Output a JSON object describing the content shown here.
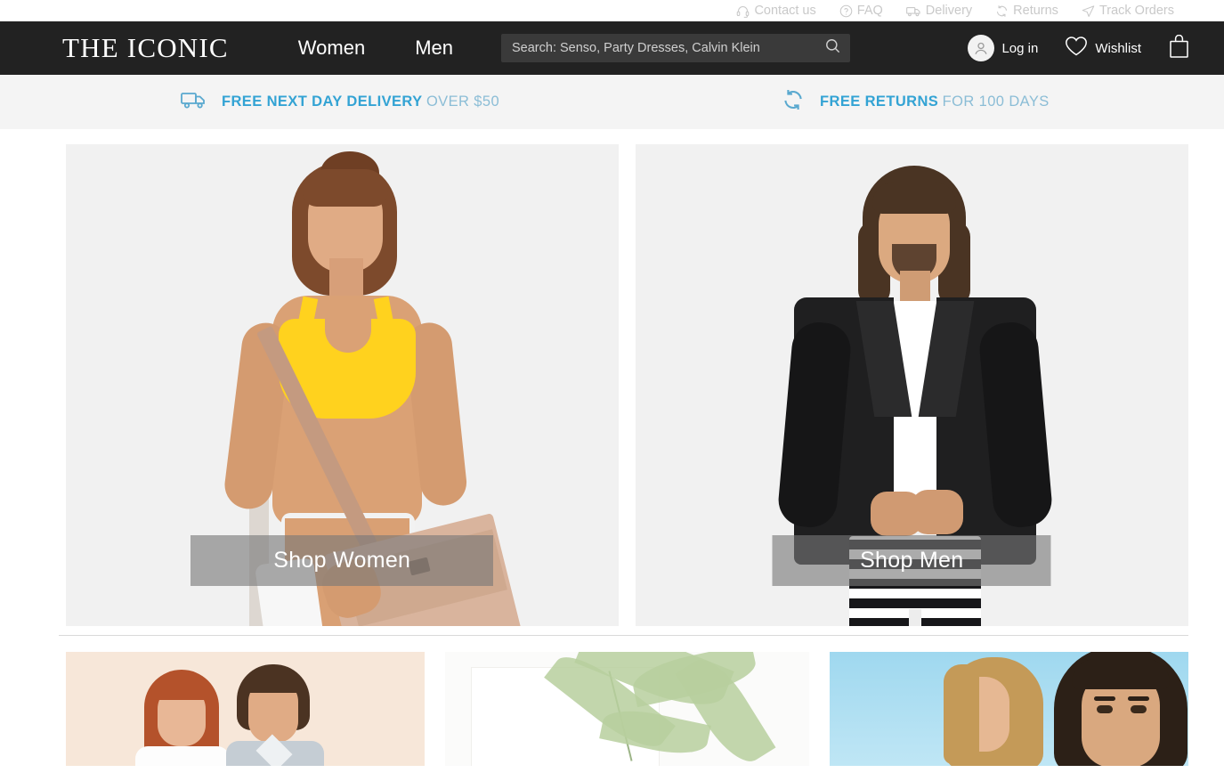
{
  "utility_bar": {
    "links": [
      {
        "label": "Contact us",
        "icon": "headset-icon"
      },
      {
        "label": "FAQ",
        "icon": "question-circle-icon"
      },
      {
        "label": "Delivery",
        "icon": "truck-icon"
      },
      {
        "label": "Returns",
        "icon": "return-arrows-icon"
      },
      {
        "label": "Track Orders",
        "icon": "paper-plane-icon"
      }
    ]
  },
  "header": {
    "logo": "THE ICONIC",
    "nav": [
      {
        "label": "Women"
      },
      {
        "label": "Men"
      }
    ],
    "search": {
      "placeholder": "Search: Senso, Party Dresses, Calvin Klein",
      "value": "",
      "icon": "search-icon"
    },
    "account": {
      "label": "Log in",
      "icon": "user-avatar-icon"
    },
    "wishlist": {
      "label": "Wishlist",
      "icon": "heart-icon"
    },
    "cart": {
      "icon": "shopping-bag-icon"
    },
    "background_color": "#222222"
  },
  "promo_banner": {
    "background_color": "#f4f4f4",
    "accent_color": "#33a3d4",
    "muted_accent_color": "#8bbdd6",
    "items": [
      {
        "icon": "delivery-truck-icon",
        "strong": "FREE NEXT DAY DELIVERY",
        "light": "OVER $50"
      },
      {
        "icon": "returns-cycle-icon",
        "strong": "FREE RETURNS",
        "light": "FOR 100 DAYS"
      }
    ]
  },
  "hero": {
    "tiles": [
      {
        "cta": "Shop Women",
        "name": "shop-women"
      },
      {
        "cta": "Shop Men",
        "name": "shop-men"
      }
    ],
    "cta_overlay_color": "rgba(120,120,120,0.62)"
  },
  "promo_tiles": [
    {
      "name": "promo-tile-couple",
      "background_color": "#f7e7d9"
    },
    {
      "name": "promo-tile-palms",
      "background_color": "#fbfbfa"
    },
    {
      "name": "promo-tile-women",
      "background_color": "#9fd8ef"
    }
  ]
}
